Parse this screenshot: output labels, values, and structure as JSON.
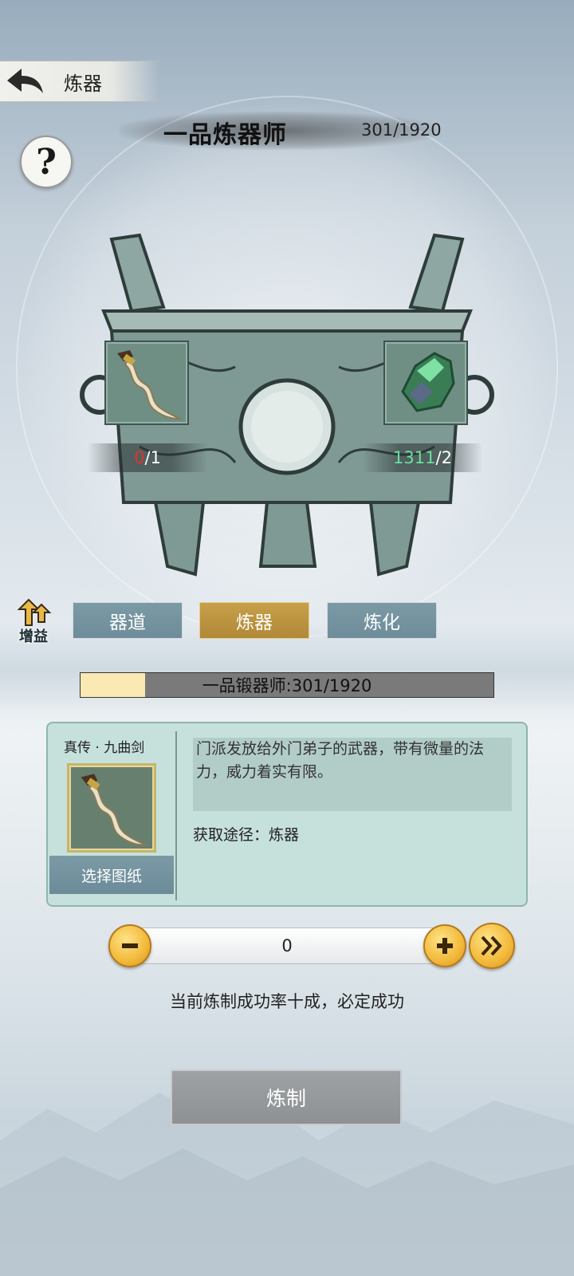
{
  "header": {
    "title": "炼器",
    "back_icon": "back-arrow-icon"
  },
  "rank": {
    "title": "一品炼器师",
    "progress": "301/1920"
  },
  "help": {
    "label": "?"
  },
  "ingredients": [
    {
      "icon": "curved-sword-icon",
      "have": "0",
      "need": "/1",
      "have_color": "#e0342f"
    },
    {
      "icon": "green-ore-icon",
      "have": "1311",
      "need": "/2",
      "have_color": "#6ae0a0"
    }
  ],
  "buff": {
    "label": "增益"
  },
  "tabs": [
    {
      "label": "器道",
      "active": false
    },
    {
      "label": "炼器",
      "active": true
    },
    {
      "label": "炼化",
      "active": false
    }
  ],
  "rank_bar": {
    "text": "一品锻器师:301/1920",
    "fill_fraction": 0.157
  },
  "blueprint": {
    "name": "真传 · 九曲剑",
    "description": "门派发放给外门弟子的武器，带有微量的法力，威力着实有限。",
    "source": "获取途径：炼器",
    "select_label": "选择图纸"
  },
  "quantity": {
    "value": "0"
  },
  "success_text": "当前炼制成功率十成，必定成功",
  "craft_button": "炼制",
  "colors": {
    "tab_active": "#b18837",
    "tab_inactive": "#6e8c99",
    "panel": "#c6e0db",
    "gold_button": "#f2b93a"
  }
}
